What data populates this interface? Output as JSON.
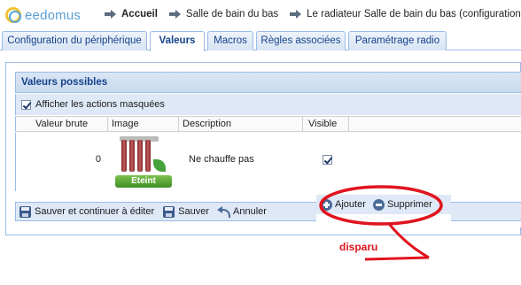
{
  "header": {
    "logo_text": "eedomus",
    "breadcrumbs": [
      {
        "label": "Accueil"
      },
      {
        "label": "Salle de bain du bas"
      },
      {
        "label": "Le radiateur Salle de bain du bas (configuration)"
      }
    ]
  },
  "tabs": [
    {
      "label": "Configuration du périphérique",
      "active": false
    },
    {
      "label": "Valeurs",
      "active": true
    },
    {
      "label": "Macros",
      "active": false
    },
    {
      "label": "Règles associées",
      "active": false
    },
    {
      "label": "Paramétrage radio",
      "active": false
    }
  ],
  "panel": {
    "title": "Valeurs possibles",
    "show_hidden_label": "Afficher les actions masquées",
    "show_hidden_checked": true,
    "columns": [
      "Valeur brute",
      "Image",
      "Description",
      "Visible"
    ],
    "rows": [
      {
        "raw_value": "0",
        "image_state_label": "Eteint",
        "image_icon": "radiator-icon",
        "description": "Ne chauffe pas",
        "visible": true
      }
    ]
  },
  "toolbar": {
    "save_continue_label": "Sauver et continuer à éditer",
    "save_label": "Sauver",
    "cancel_label": "Annuler"
  },
  "overlay": {
    "add_label": "Ajouter",
    "delete_label": "Supprimer"
  },
  "annotation": {
    "text": "disparu",
    "color": "#e0141e"
  },
  "colors": {
    "accent": "#15428b",
    "border": "#99bbe8",
    "toolbar_bg": "#dfe8f6",
    "state_green": "#46a33c"
  }
}
